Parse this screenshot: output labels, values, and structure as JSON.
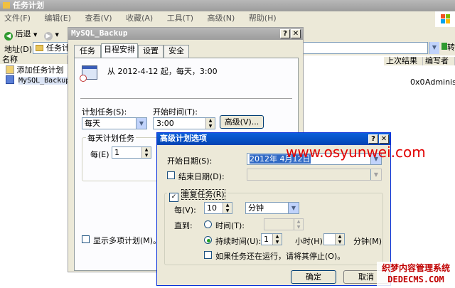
{
  "main_window": {
    "title": "任务计划",
    "menu": [
      "文件(F)",
      "编辑(E)",
      "查看(V)",
      "收藏(A)",
      "工具(T)",
      "高级(N)",
      "帮助(H)"
    ],
    "back_label": "后退",
    "address_label": "地址(D)",
    "address_value": "任务计",
    "go_label": "转到"
  },
  "task_list": {
    "header_name": "名称",
    "items": [
      "添加任务计划",
      "MySQL_Backup"
    ],
    "right_headers": [
      "上次结果",
      "编写者"
    ],
    "row_result": "0x0",
    "row_author": "Administ"
  },
  "props_dialog": {
    "title": "MySQL_Backup",
    "tabs": [
      "任务",
      "日程安排",
      "设置",
      "安全"
    ],
    "active_tab": 1,
    "schedule_summary": "从 2012-4-12 起，每天，3:00",
    "plan_task_label": "计划任务(S):",
    "plan_task_value": "每天",
    "start_time_label": "开始时间(T):",
    "start_time_value": "3:00",
    "advanced_button": "高级(V)...",
    "daily_group_label": "每天计划任务",
    "every_label": "每(E)",
    "every_value": "1",
    "show_multi_label": "显示多项计划(M)。"
  },
  "adv_dialog": {
    "title": "高级计划选项",
    "start_date_label": "开始日期(S):",
    "start_date_value": "2012年 4月12日",
    "end_date_label": "结束日期(D):",
    "repeat_label": "重复任务(R)",
    "repeat_checked": true,
    "every_label": "每(V):",
    "every_value": "10",
    "unit_value": "分钟",
    "until_label": "直到:",
    "time_label": "时间(T):",
    "duration_label": "持续时间(U):",
    "duration_value": "1",
    "hours_label": "小时(H)",
    "hours_value": "",
    "minutes_label": "分钟(M)",
    "stop_label": "如果任务还在运行，请将其停止(O)。",
    "ok_button": "确定",
    "cancel_button": "取消"
  },
  "watermarks": {
    "site": "www.osyunwei.com",
    "dede_cn": "织梦内容管理系统",
    "dede_url": "DEDECMS.COM"
  },
  "colors": {
    "title_active": "#0a5fd9",
    "title_inactive": "#a8a8a8",
    "face": "#ece9d8",
    "watermark": "#e10000"
  }
}
